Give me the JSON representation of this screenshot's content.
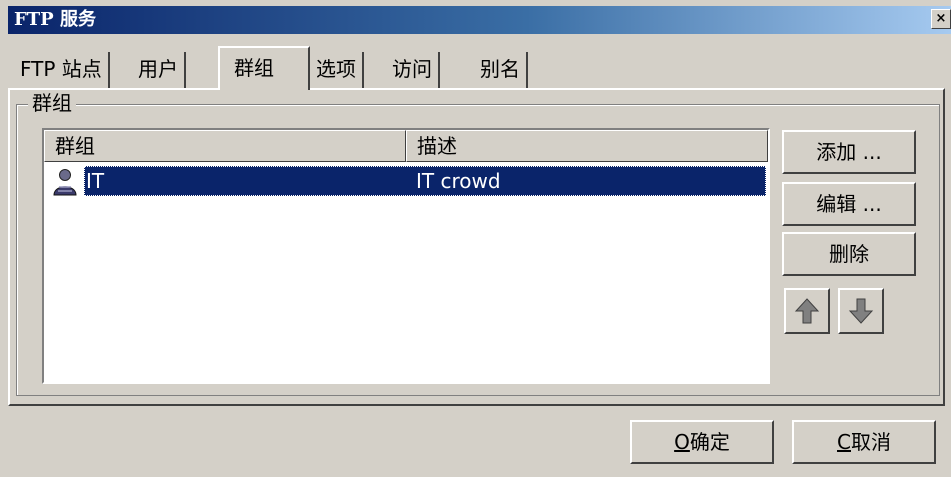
{
  "window": {
    "title": "FTP 服务",
    "close_glyph": "×"
  },
  "tabs": [
    {
      "label": "FTP 站点",
      "active": false
    },
    {
      "label": "用户",
      "active": false
    },
    {
      "label": "群组",
      "active": true
    },
    {
      "label": "选项",
      "active": false
    },
    {
      "label": "访问",
      "active": false
    },
    {
      "label": "别名",
      "active": false
    }
  ],
  "group_box": {
    "legend": "群组",
    "columns": [
      "群组",
      "描述"
    ],
    "rows": [
      {
        "name": "IT",
        "description": "IT crowd",
        "icon": "group-icon",
        "selected": true
      }
    ]
  },
  "side_buttons": {
    "add": "添加 ...",
    "edit": "编辑 ...",
    "delete": "删除",
    "move_up_icon": "arrow-up-icon",
    "move_down_icon": "arrow-down-icon"
  },
  "footer": {
    "ok_accel": "O",
    "ok_text": "确定",
    "cancel_accel": "C",
    "cancel_text": "取消"
  },
  "colors": {
    "title_start": "#0a246a",
    "title_end": "#a6caf0",
    "selection": "#0a246a",
    "face": "#d4d0c8"
  }
}
